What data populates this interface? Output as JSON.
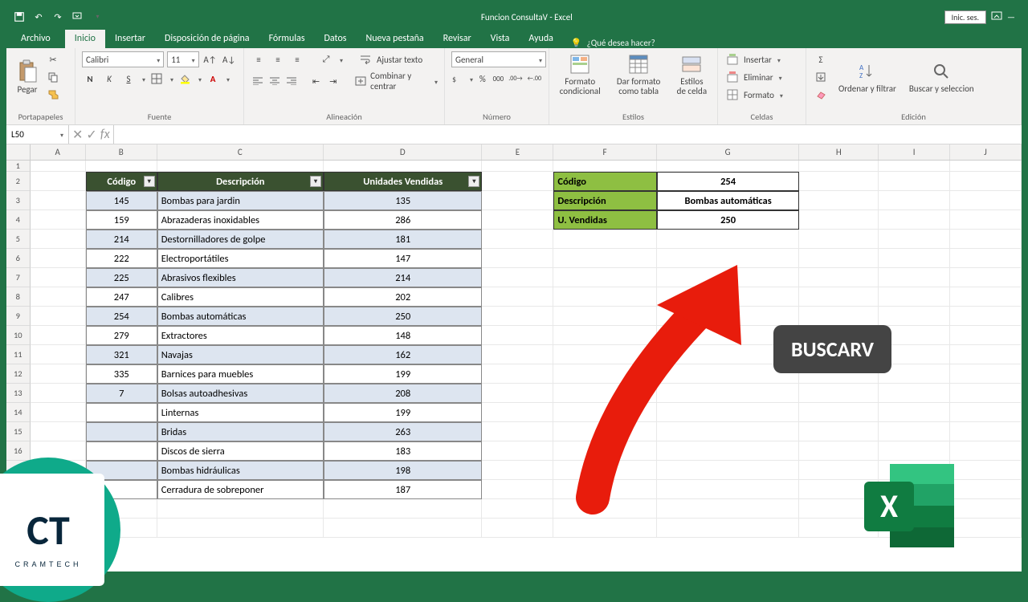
{
  "title": "Funcion ConsultaV  -  Excel",
  "signin": "Inic. ses.",
  "tabs": {
    "file": "Archivo",
    "home": "Inicio",
    "insert": "Insertar",
    "layout": "Disposición de página",
    "formulas": "Fórmulas",
    "data": "Datos",
    "newtab": "Nueva pestaña",
    "review": "Revisar",
    "view": "Vista",
    "help": "Ayuda",
    "tell": "¿Qué desea hacer?"
  },
  "ribbon": {
    "clipboard": {
      "paste": "Pegar",
      "label": "Portapapeles"
    },
    "font": {
      "name": "Calibri",
      "size": "11",
      "label": "Fuente"
    },
    "align": {
      "wrap": "Ajustar texto",
      "merge": "Combinar y centrar",
      "label": "Alineación"
    },
    "number": {
      "format": "General",
      "label": "Número"
    },
    "styles": {
      "cond": "Formato condicional",
      "table": "Dar formato como tabla",
      "cell": "Estilos de celda",
      "label": "Estilos"
    },
    "cells": {
      "insert": "Insertar",
      "delete": "Eliminar",
      "format": "Formato",
      "label": "Celdas"
    },
    "editing": {
      "sort": "Ordenar y filtrar",
      "find": "Buscar y seleccion",
      "label": "Edición"
    }
  },
  "namebox": "L50",
  "columns": [
    "A",
    "B",
    "C",
    "D",
    "E",
    "F",
    "G",
    "H",
    "I",
    "J"
  ],
  "table": {
    "headers": {
      "code": "Código",
      "desc": "Descripción",
      "units": "Unidades Vendidas"
    },
    "rows": [
      {
        "code": "145",
        "desc": "Bombas para jardin",
        "units": "135"
      },
      {
        "code": "159",
        "desc": "Abrazaderas inoxidables",
        "units": "286"
      },
      {
        "code": "214",
        "desc": "Destornilladores de golpe",
        "units": "181"
      },
      {
        "code": "222",
        "desc": "Electroportátiles",
        "units": "147"
      },
      {
        "code": "225",
        "desc": "Abrasivos flexibles",
        "units": "214"
      },
      {
        "code": "247",
        "desc": "Calibres",
        "units": "202"
      },
      {
        "code": "254",
        "desc": "Bombas automáticas",
        "units": "250"
      },
      {
        "code": "279",
        "desc": "Extractores",
        "units": "148"
      },
      {
        "code": "321",
        "desc": "Navajas",
        "units": "162"
      },
      {
        "code": "335",
        "desc": "Barnices para muebles",
        "units": "199"
      },
      {
        "code": "7",
        "desc": "Bolsas autoadhesivas",
        "units": "208"
      },
      {
        "code": "",
        "desc": "Linternas",
        "units": "199"
      },
      {
        "code": "",
        "desc": "Bridas",
        "units": "263"
      },
      {
        "code": "",
        "desc": "Discos de sierra",
        "units": "183"
      },
      {
        "code": "",
        "desc": "Bombas hidráulicas",
        "units": "198"
      },
      {
        "code": "",
        "desc": "Cerradura de sobreponer",
        "units": "187"
      }
    ]
  },
  "lookup": {
    "labels": {
      "code": "Código",
      "desc": "Descripción",
      "units": "U. Vendidas"
    },
    "values": {
      "code": "254",
      "desc": "Bombas automáticas",
      "units": "250"
    }
  },
  "badge": "BUSCARV",
  "logo_letters": "CT",
  "excel_x": "X"
}
